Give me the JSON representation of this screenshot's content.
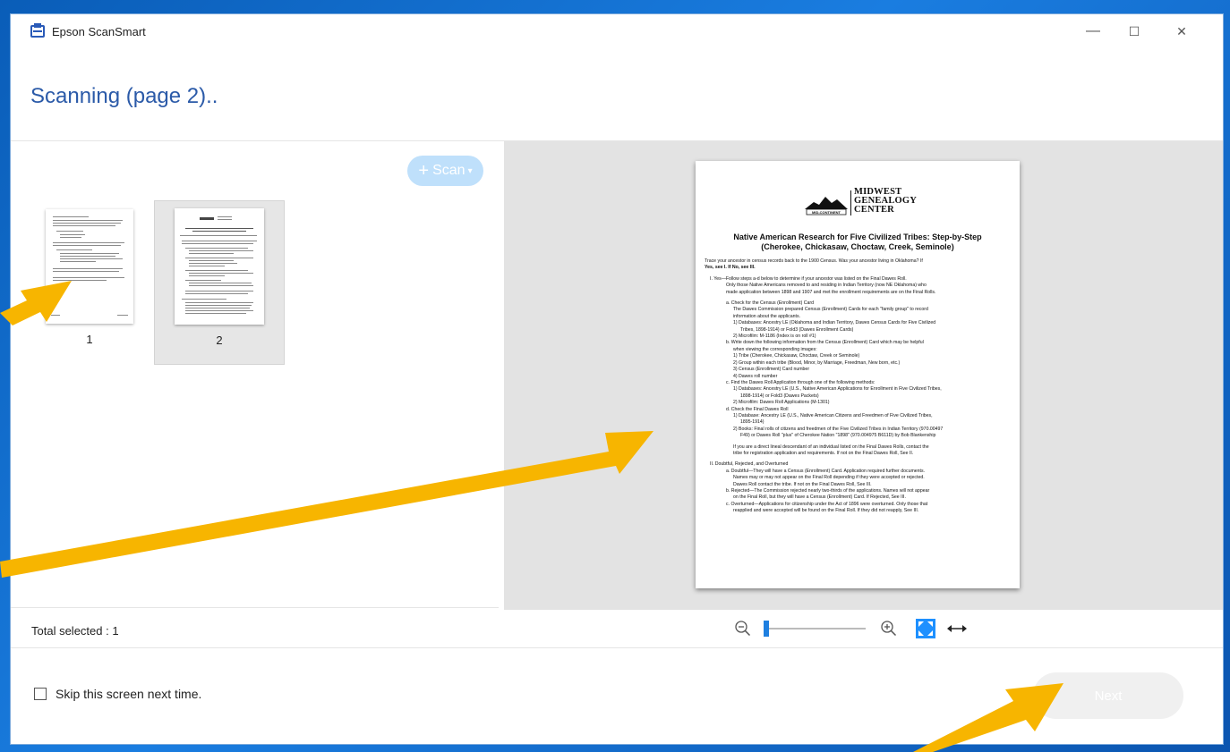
{
  "window": {
    "title": "Epson ScanSmart",
    "heading": "Scanning (page 2)..",
    "controls": {
      "minimize": "—",
      "maximize": "☐",
      "close": "✕"
    }
  },
  "scan_button": {
    "label": "Scan",
    "plus": "+",
    "caret": "▾"
  },
  "thumbnails": [
    {
      "number": "1",
      "selected": false
    },
    {
      "number": "2",
      "selected": true
    }
  ],
  "status": {
    "total_selected": "Total selected : 1"
  },
  "zoom": {
    "level_fraction": 0.0
  },
  "skip_checkbox": {
    "label": "Skip this screen next time.",
    "checked": false
  },
  "next_button": {
    "label": "Next",
    "enabled": false
  },
  "document": {
    "logo_lines": [
      "MIDWEST",
      "GENEALOGY",
      "CENTER"
    ],
    "logo_sub": "MID-CONTINENT",
    "title_line1": "Native American Research for Five Civilized Tribes: Step-by-Step",
    "title_line2": "(Cherokee, Chickasaw, Choctaw, Creek, Seminole)",
    "intro_a": "Trace your ancestor in census records back to the 1900 Census. Was your ancestor living in Oklahoma? If",
    "intro_b": "Yes, see I. If No, see III.",
    "s1_a": "I.     Yes—Follow steps a-d below to determine if your ancestor was listed on the Final Dawes Roll.",
    "s1_b": "Only those Native Americans removed to and residing in Indian Territory (now NE Oklahoma) who",
    "s1_c": "made application between 1898 and 1907 and met the enrollment requirements are on the Final Rolls.",
    "a1": "a.   Check for the Census (Enrollment) Card",
    "a2": "The Dawes Commission prepared Census (Enrollment) Cards for each \"family group\" to record",
    "a3": "information about the applicants.",
    "a4": "1)   Databases: Ancestry LE (Oklahoma and Indian Territory, Dawes Census Cards for Five Civilized",
    "a5": "Tribes, 1898-1914) or Fold3 (Dawes Enrollment Cards)",
    "a6": "2)   Microfilm: M-1186 (Index is on roll #1)",
    "b1": "b.   Write down the following information from the Census (Enrollment) Card which may be helpful",
    "b2": "when viewing the corresponding images:",
    "b3": "1)   Tribe (Cherokee, Chickasaw, Choctaw, Creek or Seminole)",
    "b4": "2)   Group within each tribe (Blood, Minor, by Marriage, Freedman, New born, etc.)",
    "b5": "3)   Census (Enrollment) Card number",
    "b6": "4)   Dawes roll number",
    "c1": "c.   Find the Dawes Roll Application through one of the following methods:",
    "c2": "1)   Databases: Ancestry LE (U.S., Native American Applications for Enrollment in Five Civilized Tribes,",
    "c3": "1898-1914) or Fold3 (Dawes Packets)",
    "c4": "2)   Microfilm: Dawes Roll Applications (M-1301)",
    "d1": "d.   Check the Final Dawes Roll",
    "d2": "1)   Database: Ancestry LE (U.S., Native American Citizens and Freedmen of Five Civilized Tribes,",
    "d3": "1895-1914)",
    "d4": "2)   Books: Final rolls of citizens and freedmen of the Five Civilized Tribes in Indian Territory (970.00497",
    "d5": "F49) or Dawes Roll \"plus\" of Cherokee Nation \"1898\" (970.004975 B611D) by Bob Blankenship",
    "e1": "If you are a direct lineal descendant of an individual listed on the Final Dawes Rolls, contact the",
    "e2": "tribe for registration application and requirements. If not on the Final Dawes Roll, See II.",
    "s2": "II.    Doubtful, Rejected, and Overturned",
    "f1": "a.   Doubtful—They will have a Census (Enrollment) Card. Application required further documents.",
    "f2": "Names may or may not appear on the Final Roll depending if they were accepted or rejected.",
    "f3": "Dawes Roll contact the tribe. If not on the Final Dawes Roll, See III.",
    "f4": "b.   Rejected—The Commission rejected nearly two-thirds of the applications. Names will not appear",
    "f5": "on the Final Roll, but they will have a Census (Enrollment) Card. If Rejected, See III.",
    "f6": "c.   Overturned—Applications for citizenship under the Act of 1896 were overturned. Only those that",
    "f7": "reapplied and were accepted will be found on the Final Roll. If they did not reapply, See III."
  },
  "colors": {
    "accent": "#2b5aa8",
    "annotation_arrow": "#f7b500",
    "preview_bg": "#e3e3e3",
    "zoom_fit": "#1e90ff"
  },
  "icons": [
    "epson-scansmart-app-icon",
    "zoom-out-icon",
    "zoom-in-icon",
    "fit-page-icon",
    "fit-width-icon"
  ]
}
